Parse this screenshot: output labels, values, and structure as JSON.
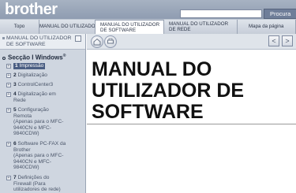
{
  "header": {
    "logo": "brother",
    "search_button": "Procura"
  },
  "tabs": [
    {
      "label": "Topo"
    },
    {
      "label": "MANUAL DO UTILIZADOR"
    },
    {
      "line1": "MANUAL DO UTILIZADOR",
      "line2": "DE SOFTWARE"
    },
    {
      "line1": "MANUAL DO UTILIZADOR",
      "line2": "DE REDE"
    },
    {
      "label": "Mapa da página"
    }
  ],
  "sidebar": {
    "top_line1": "MANUAL DO UTILIZADOR",
    "top_line2": "DE SOFTWARE",
    "section_title": "Secção I Windows",
    "section_mark": "®",
    "items": [
      {
        "num": "1",
        "lines": [
          "Impressão"
        ]
      },
      {
        "num": "2",
        "lines": [
          "Digitalização"
        ]
      },
      {
        "num": "3",
        "lines": [
          "ControlCenter3"
        ]
      },
      {
        "num": "4",
        "lines": [
          "Digitalização em",
          "Rede"
        ]
      },
      {
        "num": "5",
        "lines": [
          "Configuração",
          "Remota",
          "(Apenas para o MFC-",
          "9440CN e MFC-",
          "9840CDW)"
        ]
      },
      {
        "num": "6",
        "lines": [
          "Software PC-FAX da",
          "Brother",
          "(Apenas para o MFC-",
          "9440CN e MFC-",
          "9840CDW)"
        ]
      },
      {
        "num": "7",
        "lines": [
          "Definições do",
          "Firewall (Para",
          "utilizadores de rede)"
        ]
      }
    ]
  },
  "main": {
    "title_lines": [
      "MANUAL DO",
      "UTILIZADOR DE",
      "SOFTWARE"
    ],
    "prev_glyph": "<",
    "next_glyph": ">"
  }
}
